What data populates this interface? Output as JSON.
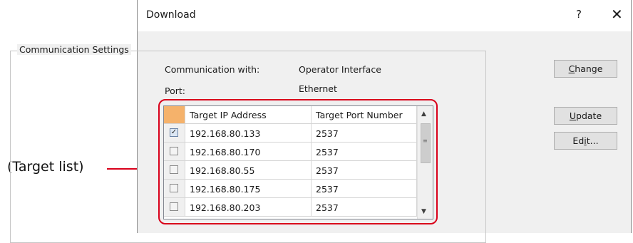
{
  "callout": {
    "text": "(Target list)"
  },
  "window": {
    "title": "Download",
    "help_label": "?",
    "close_label": "✕"
  },
  "group": {
    "label": "Communication Settings"
  },
  "settings": {
    "communication_label": "Communication with:",
    "communication_value": "Operator Interface",
    "port_label": "Port:",
    "port_value": "Ethernet"
  },
  "buttons": {
    "change_prefix": "C",
    "change_rest": "hange",
    "update_prefix": "U",
    "update_rest": "pdate",
    "edit_pre": "Ed",
    "edit_access": "i",
    "edit_post": "t..."
  },
  "table": {
    "headers": [
      "Target IP Address",
      "Target Port Number"
    ],
    "rows": [
      {
        "checked": true,
        "check_glyph": "✓",
        "ip": "192.168.80.133",
        "port": "2537"
      },
      {
        "checked": false,
        "check_glyph": "",
        "ip": "192.168.80.170",
        "port": "2537"
      },
      {
        "checked": false,
        "check_glyph": "",
        "ip": "192.168.80.55",
        "port": "2537"
      },
      {
        "checked": false,
        "check_glyph": "",
        "ip": "192.168.80.175",
        "port": "2537"
      },
      {
        "checked": false,
        "check_glyph": "",
        "ip": "192.168.80.203",
        "port": "2537"
      }
    ]
  },
  "scrollbar": {
    "up_glyph": "▲",
    "down_glyph": "▼",
    "grip_glyph": "≡"
  },
  "colors": {
    "highlight": "#d9001b",
    "header_corner": "#f5b26b"
  }
}
